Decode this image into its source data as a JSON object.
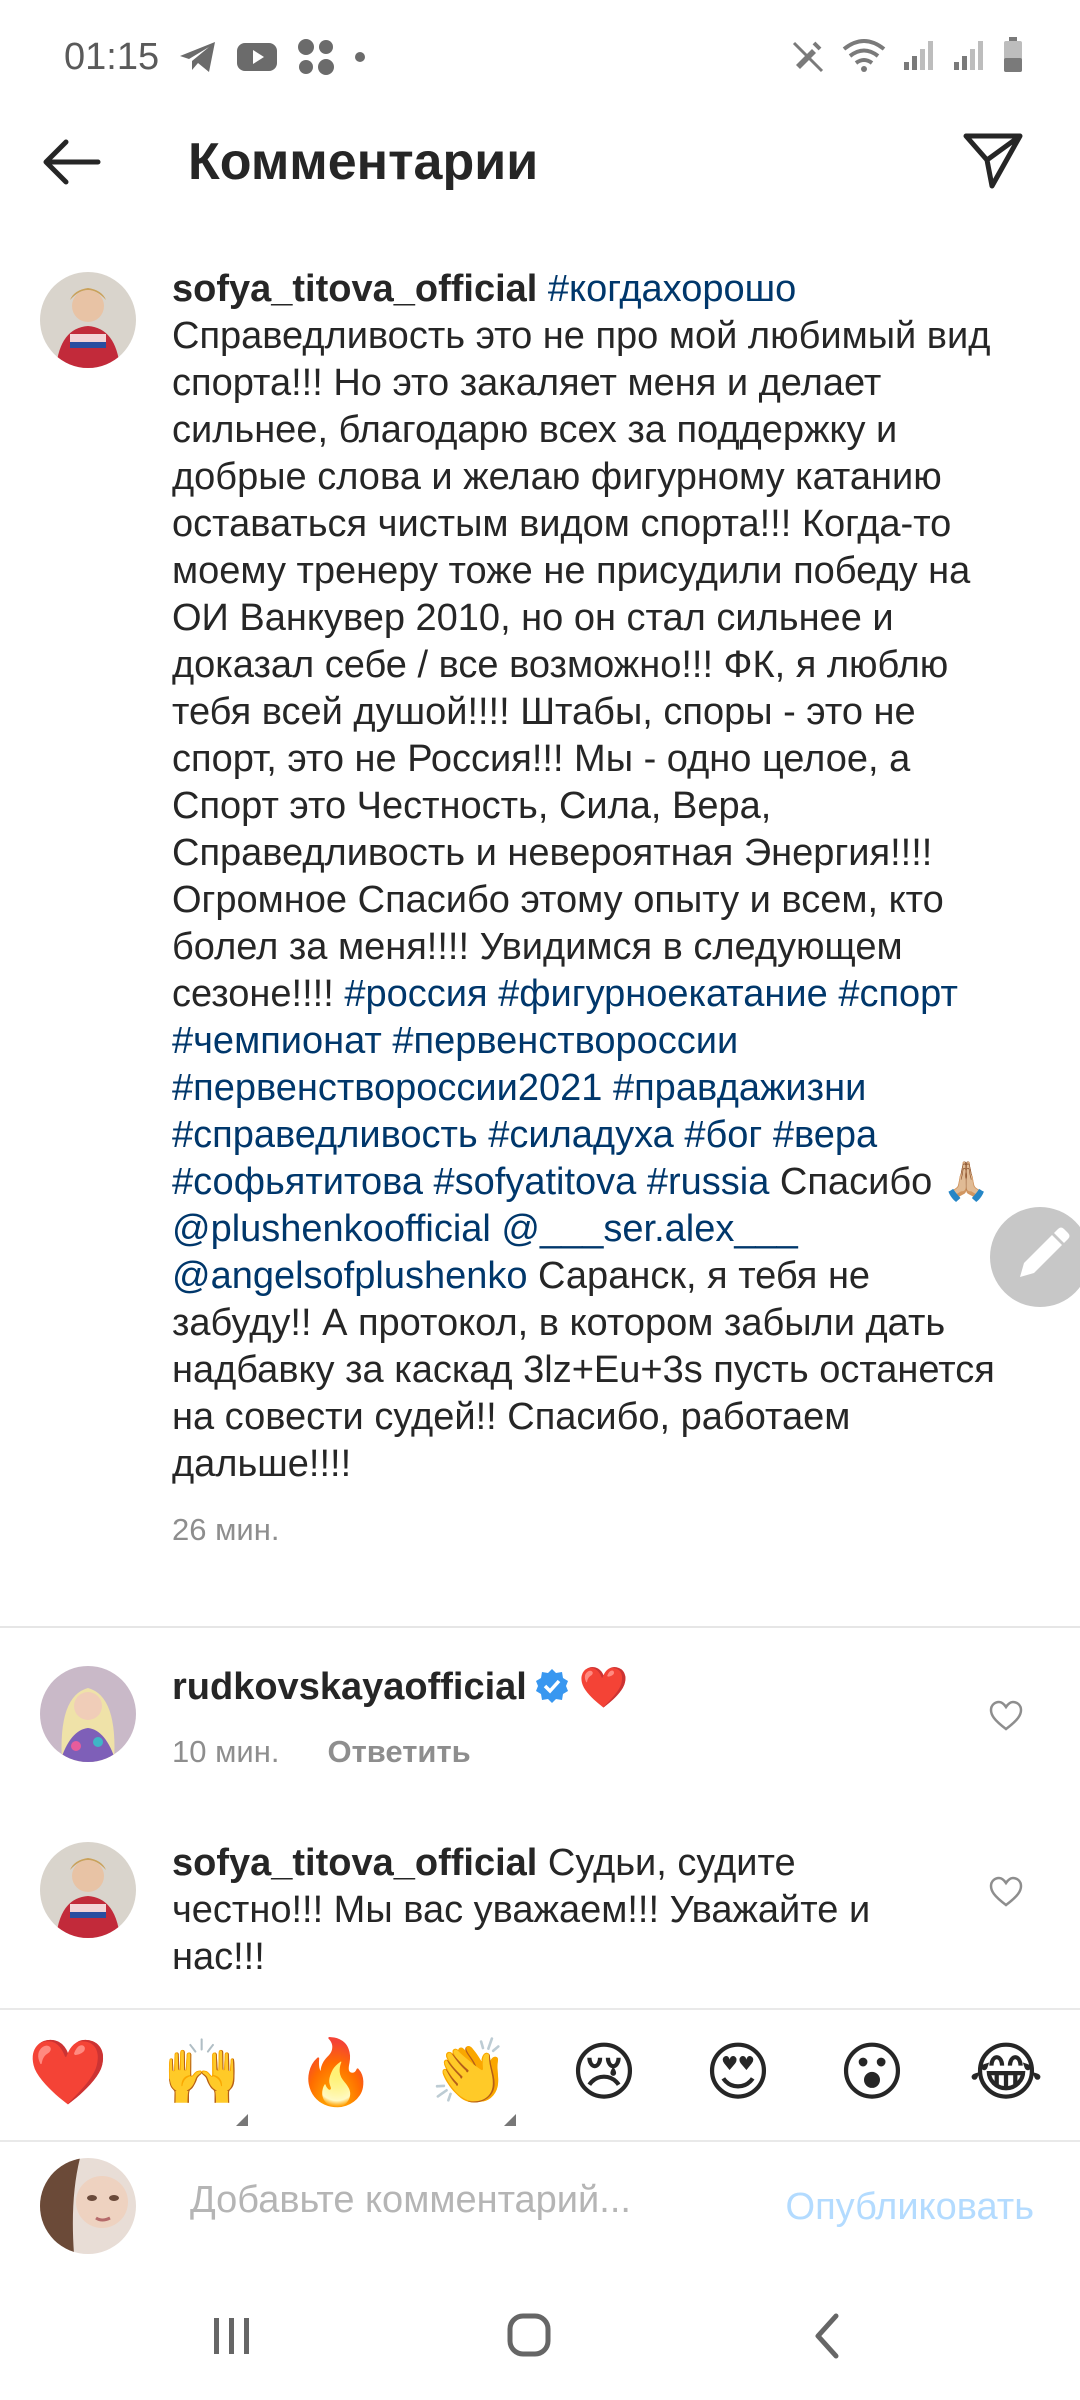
{
  "status_bar": {
    "time": "01:15"
  },
  "header": {
    "title": "Комментарии"
  },
  "caption": {
    "username": "sofya_titova_official",
    "first_tag": "#когдахорошо",
    "text_1": "Справедливость это не про мой любимый вид спорта!!! Но это закаляет меня и делает сильнее, благодарю всех за поддержку и добрые слова и желаю фигурному катанию оставаться чистым видом спорта!!! Когда-то моему тренеру тоже не присудили победу на ОИ Ванкувер 2010, но он стал сильнее и доказал себе / все возможно!!! ФК, я люблю тебя всей душой!!!! Штабы, споры - это не спорт, это не Россия!!! Мы - одно целое, а Спорт это Честность, Сила, Вера, Справедливость и невероятная Энергия!!!! Огромное Спасибо этому опыту и всем, кто болел за меня!!!! Увидимся в следующем сезоне!!!! ",
    "tags": "#россия #фигурноекатание #спорт #чемпионат #первенствороссии #первенствороссии2021 #правдажизни #справедливость #силадуха #бог #вера #софьятитова #sofyatitova #russia",
    "text_2": " Спасибо 🙏🏼 ",
    "mention_1": "@plushenkoofficial",
    "mention_2": "@___ser.alex___",
    "mention_3": "@angelsofplushenko",
    "text_3": " Саранск, я тебя не забуду!! А протокол, в котором забыли дать надбавку за каскад 3lz+Eu+3s пусть останется на совести судей!! Спасибо, работаем дальше!!!!",
    "time": "26 мин."
  },
  "comments": [
    {
      "username": "rudkovskayaofficial",
      "text": "❤️",
      "time": "10 мин.",
      "reply": "Ответить"
    },
    {
      "username": "sofya_titova_official",
      "text": "Судьи, судите честно!!! Мы вас уважаем!!! Уважайте и нас!!!"
    }
  ],
  "emoji_bar": [
    "❤️",
    "🙌",
    "🔥",
    "👏",
    "😢",
    "😍",
    "😮",
    "😂"
  ],
  "input": {
    "placeholder": "Добавьте комментарий...",
    "publish": "Опубликовать"
  }
}
